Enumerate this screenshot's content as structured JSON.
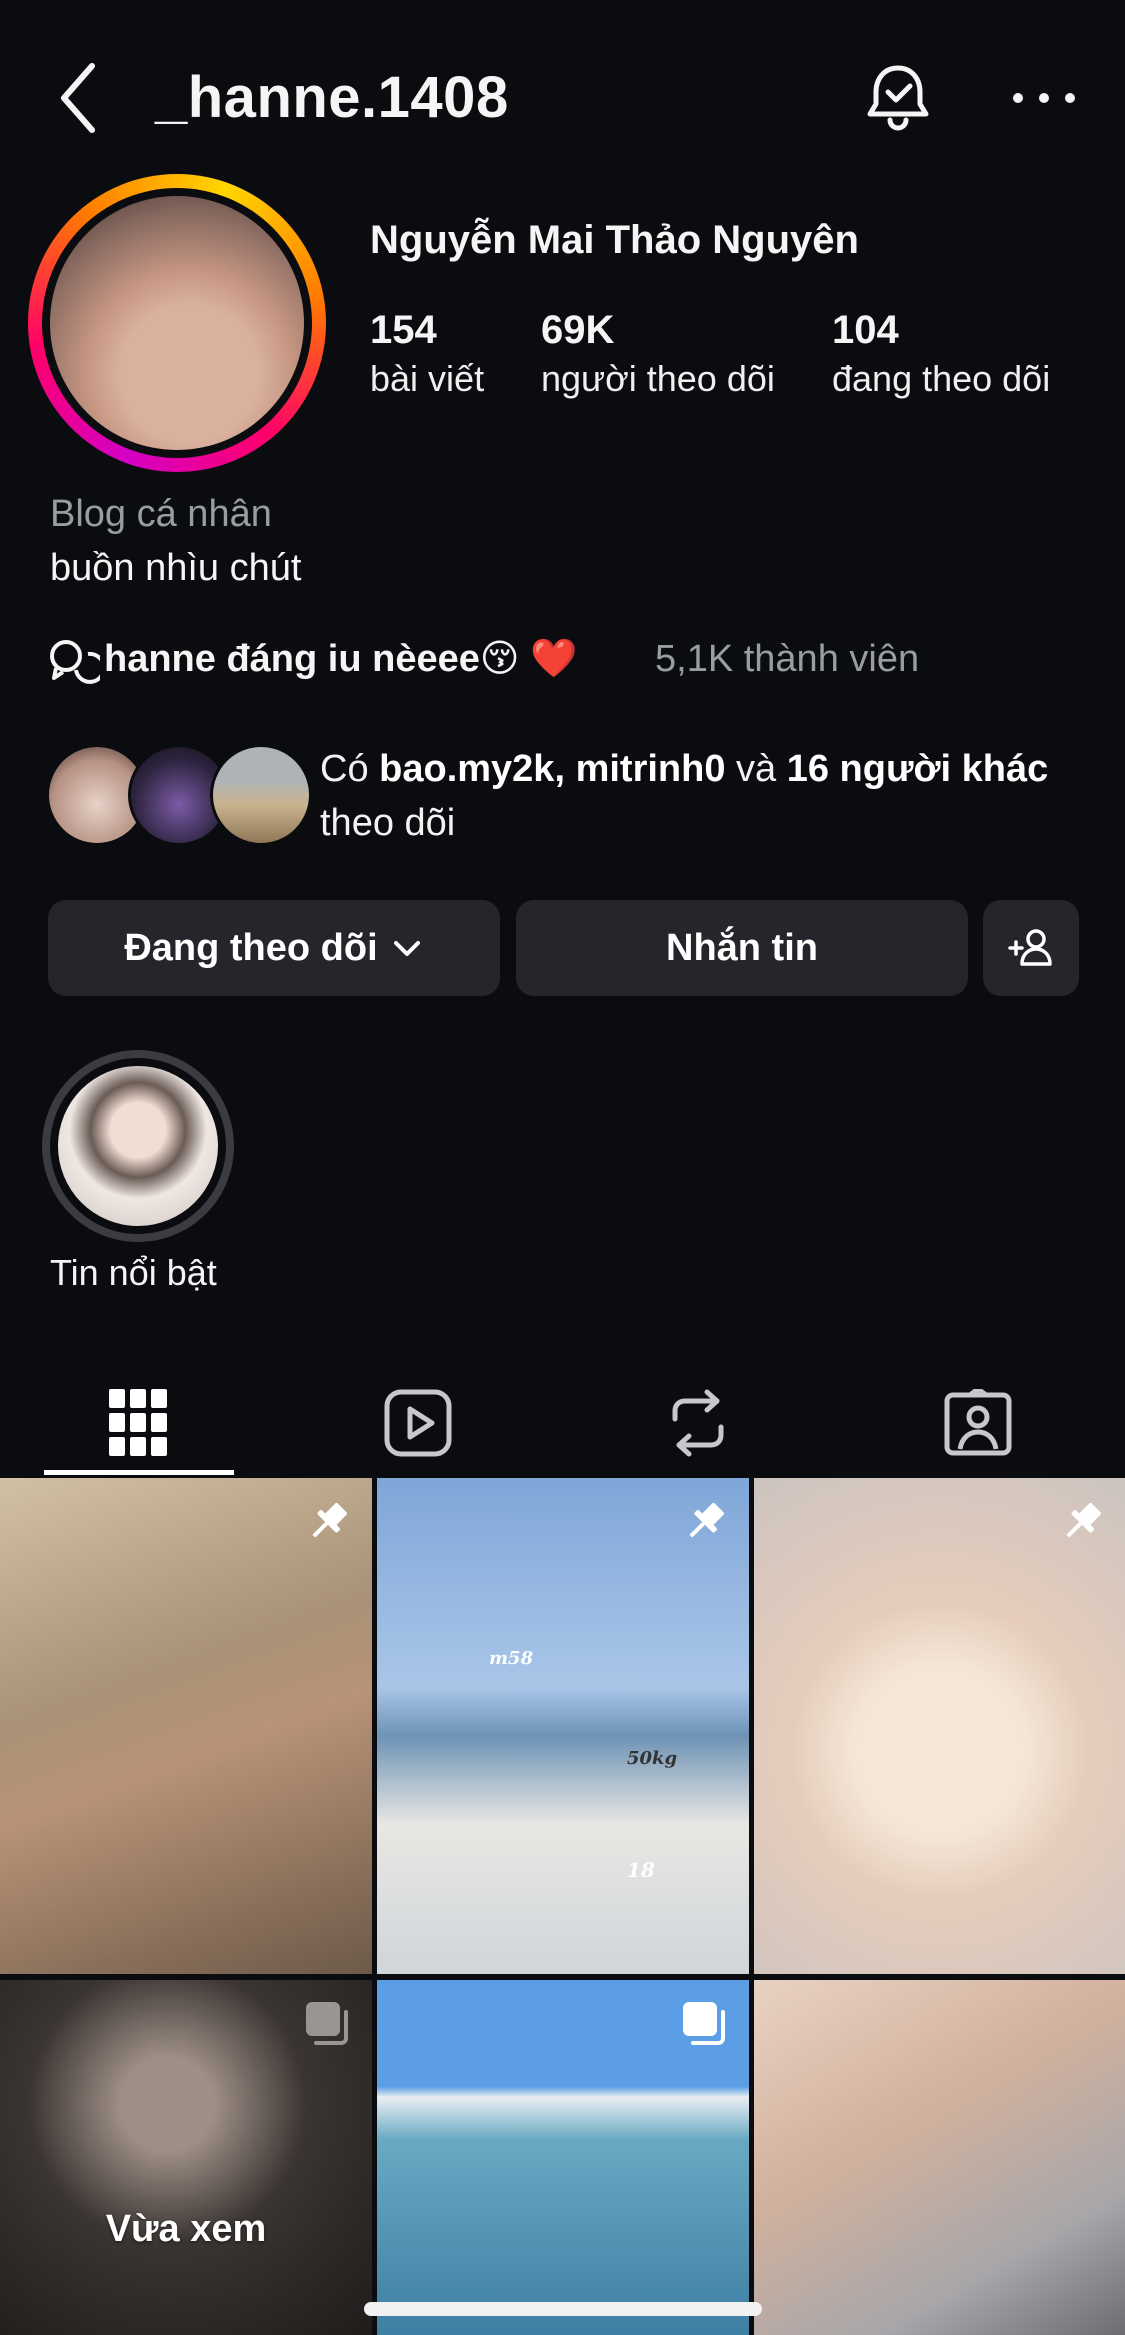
{
  "header": {
    "username": "_hanne.1408"
  },
  "profile": {
    "full_name": "Nguyễn Mai Thảo Nguyên",
    "stats": [
      {
        "value": "154",
        "label": "bài viết"
      },
      {
        "value": "69K",
        "label": "người theo dõi"
      },
      {
        "value": "104",
        "label": "đang theo dõi"
      }
    ],
    "category": "Blog cá nhân",
    "bio": "buồn nhìu chút",
    "channel": {
      "name": "hanne đáng iu nèeee😚 ❤️",
      "members": "5,1K thành viên"
    },
    "mutual": {
      "prefix": "Có ",
      "user1": "bao.my2k",
      "sep": ", ",
      "user2": "mitrinh0",
      "and": " và ",
      "others": "16 người khác",
      "suffix": " theo dõi"
    }
  },
  "buttons": {
    "following": "Đang theo dõi",
    "message": "Nhắn tin"
  },
  "highlight": {
    "label": "Tin nổi bật"
  },
  "grid": {
    "recent_label": "Vừa xem",
    "cell_text": {
      "cell2_a": "m58",
      "cell2_b": "50kg",
      "cell2_c": "18"
    }
  }
}
